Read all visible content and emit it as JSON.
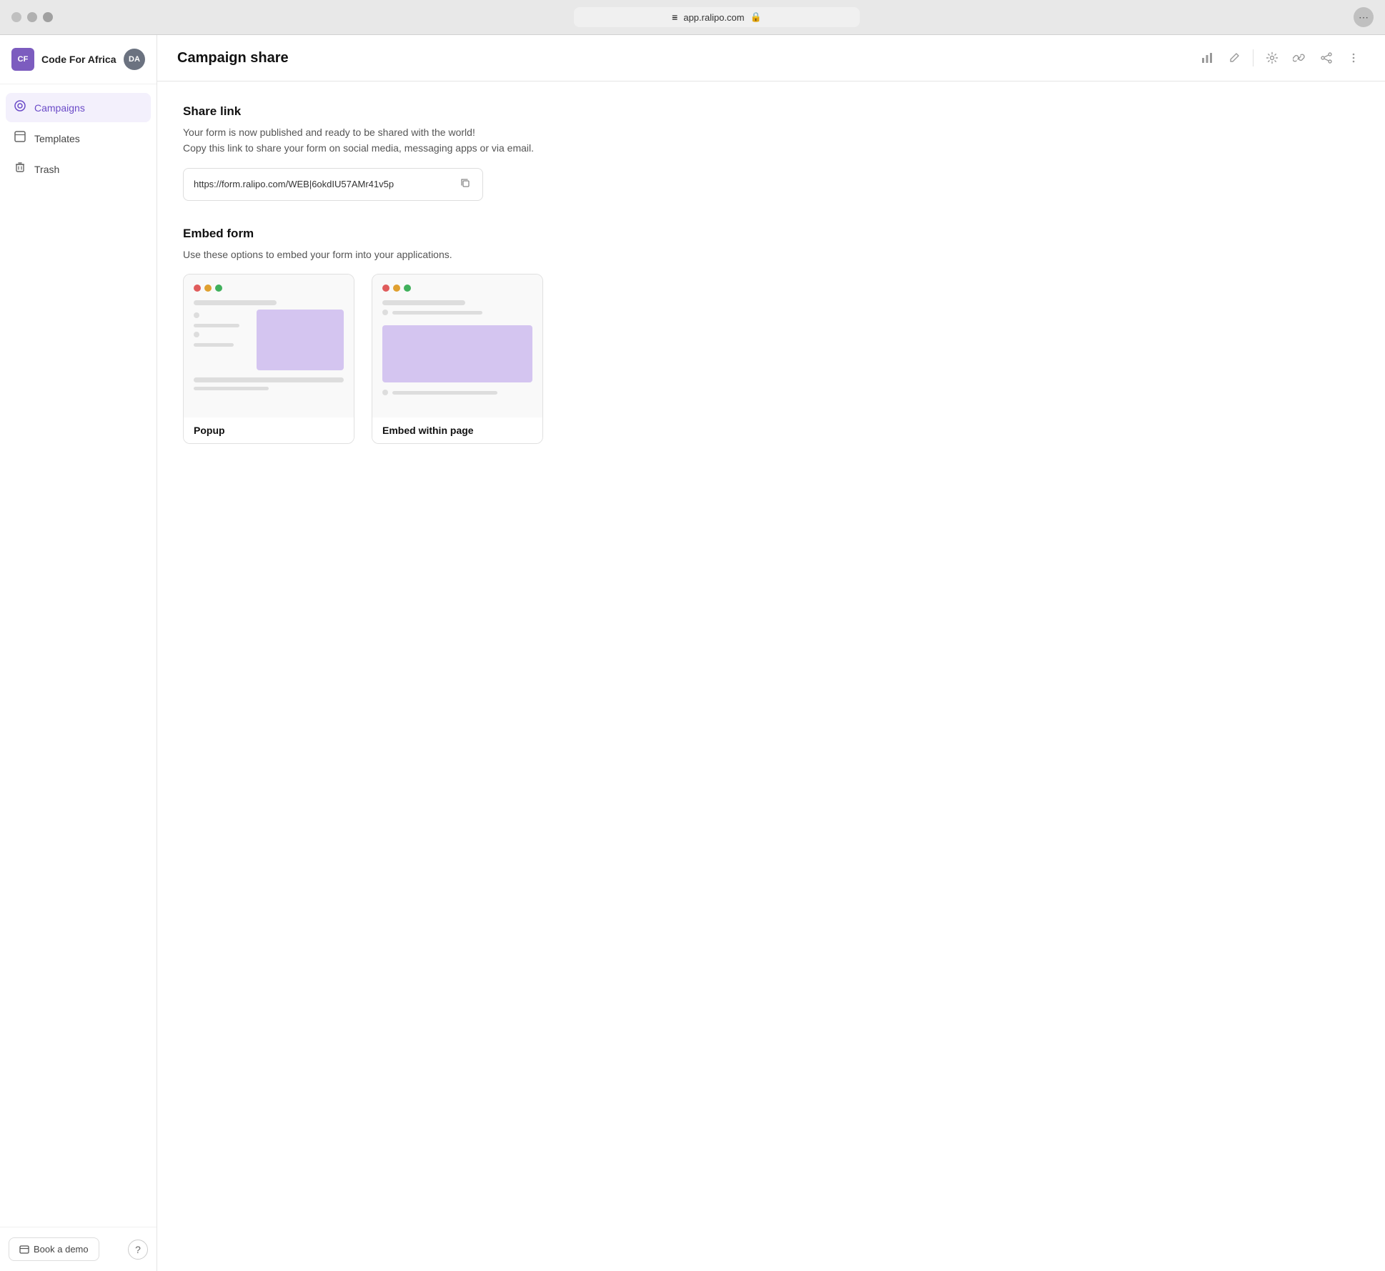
{
  "browser": {
    "address": "app.ralipo.com",
    "lock_icon": "🔒",
    "menu_icon": "⋯"
  },
  "sidebar": {
    "org_initials": "CF",
    "org_name": "Code For Africa",
    "user_initials": "DA",
    "nav_items": [
      {
        "id": "campaigns",
        "label": "Campaigns",
        "icon": "◎",
        "active": true
      },
      {
        "id": "templates",
        "label": "Templates",
        "icon": "⊡",
        "active": false
      },
      {
        "id": "trash",
        "label": "Trash",
        "icon": "🗑",
        "active": false
      }
    ],
    "book_demo_label": "Book a demo",
    "help_icon": "?"
  },
  "header": {
    "title": "Campaign share",
    "actions": {
      "chart_icon": "📊",
      "edit_icon": "✏",
      "settings_icon": "⚙",
      "link_icon": "🔗",
      "share_icon": "↗",
      "more_icon": "⋯"
    }
  },
  "share_link": {
    "title": "Share link",
    "description_line1": "Your form is now published and ready to be shared with the world!",
    "description_line2": "Copy this link to share your form on social media, messaging apps or via email.",
    "url": "https://form.ralipo.com/WEB|6okdIU57AMr41v5p",
    "copy_icon": "⧉"
  },
  "embed_form": {
    "title": "Embed form",
    "description": "Use these options to embed your form into your applications.",
    "options": [
      {
        "id": "popup",
        "label": "Popup"
      },
      {
        "id": "embed-within-page",
        "label": "Embed within page"
      }
    ]
  }
}
